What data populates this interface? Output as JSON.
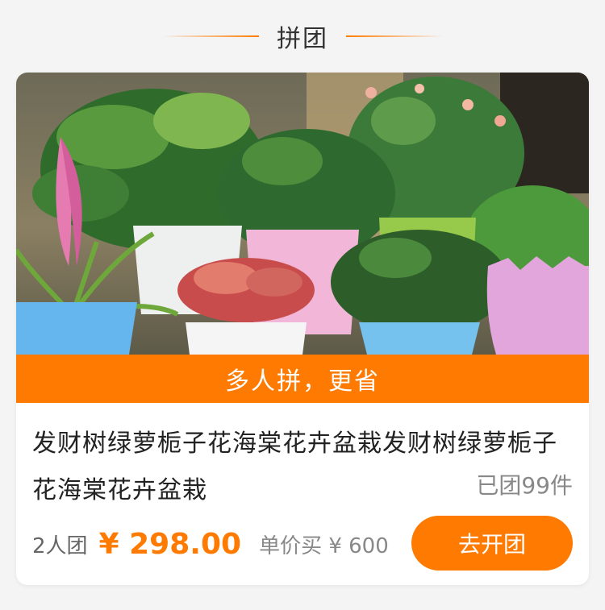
{
  "header": {
    "title": "拼团"
  },
  "product": {
    "image_alt": "",
    "promo_banner": "多人拼，更省",
    "title": "发财树绿萝栀子花海棠花卉盆栽发财树绿萝栀子花海棠花卉盆栽",
    "sold_count": "已团99件",
    "group_size": "2人团",
    "group_price": "¥ 298.00",
    "single_price": "单价买 ¥ 600",
    "button_label": "去开团"
  },
  "colors": {
    "accent": "#ff7a00",
    "background": "#f4f4f4",
    "card": "#ffffff"
  }
}
